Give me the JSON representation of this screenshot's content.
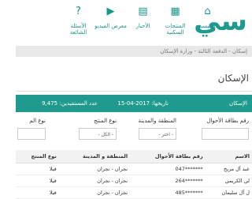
{
  "header": {
    "logo_text": "سي",
    "nav": [
      {
        "label": "الرئيسية",
        "icon": "house-icon"
      },
      {
        "label": "المنتجات السكنية",
        "icon": "building-icon"
      },
      {
        "label": "الأخبار",
        "icon": "newspaper-icon"
      },
      {
        "label": "معرض الفيديو",
        "icon": "video-icon"
      },
      {
        "label": "الأسئلة الشائعة",
        "icon": "question-icon"
      }
    ]
  },
  "breadcrumb": "إسكان - الدفعة الثالثة - وزارة الإسكان",
  "page_title": "الإسكان",
  "info_bar": {
    "left_label": "الإسكان",
    "date": "تاريخها: 2017-04-15",
    "beneficiaries": "عدد المستفيدين: 9,475"
  },
  "filters": {
    "id_label": "رقم بطاقة الأحوال",
    "region_label": "المنطقة والمدينة",
    "product_label": "نوع المنتج",
    "product2_label": "نوع الم",
    "region_value": "- اختر -",
    "product_value": "- الكل -"
  },
  "table": {
    "headers": [
      "الاسم",
      "رقم بطاقة الأحوال",
      "المنطقة و المدينة",
      "نوع المنتج"
    ],
    "rows": [
      [
        "عبد آل مريح",
        "*******047",
        "نجران - نجران",
        "فيلا"
      ],
      [
        "لي الكريمي",
        "*******264",
        "نجران - نجران",
        "فيلا"
      ],
      [
        "ل آل سليمان",
        "*******485",
        "نجران - نجران",
        "فيلا"
      ]
    ]
  },
  "colors": {
    "accent": "#1e9a8f"
  }
}
